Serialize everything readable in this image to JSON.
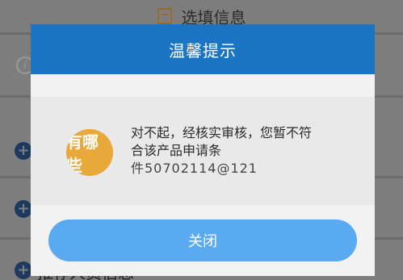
{
  "background": {
    "header_title": "选填信息",
    "footer_text": "推荐人员信息"
  },
  "dialog": {
    "title": "温馨提示",
    "avatar_text": "有哪些",
    "message_lines": [
      "对不起，经核实审核，您暂不符",
      "合该产品申请条",
      "件50702114@121"
    ],
    "close_label": "关闭"
  }
}
